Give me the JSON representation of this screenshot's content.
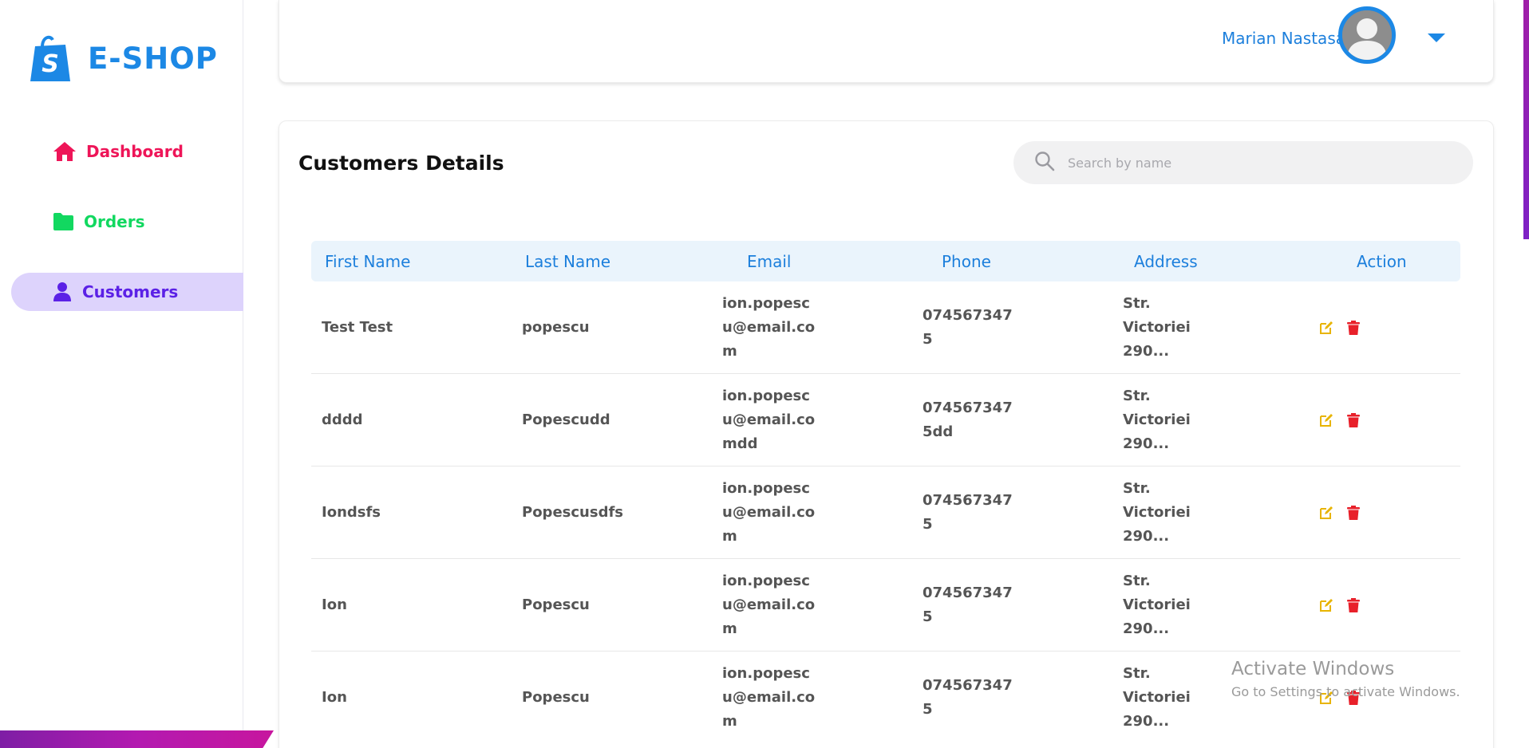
{
  "app": {
    "brand": "E-SHOP"
  },
  "sidebar": {
    "items": [
      {
        "label": "Dashboard",
        "icon": "home-icon",
        "color": "#ee1558"
      },
      {
        "label": "Orders",
        "icon": "folder-icon",
        "color": "#12d860"
      },
      {
        "label": "Customers",
        "icon": "user-icon",
        "color": "#5b21e6",
        "active": true
      }
    ]
  },
  "header": {
    "user_name": "Marian Nastasa"
  },
  "main": {
    "title": "Customers Details",
    "search": {
      "placeholder": "Search by name",
      "value": ""
    },
    "table": {
      "columns": [
        "First Name",
        "Last Name",
        "Email",
        "Phone",
        "Address",
        "Action"
      ],
      "rows": [
        {
          "first_name": "Test Test",
          "last_name": "popescu",
          "email": "ion.popescu@email.com",
          "phone": "0745673475",
          "address": "Str. Victoriei 290..."
        },
        {
          "first_name": "dddd",
          "last_name": "Popescudd",
          "email": "ion.popescu@email.comdd",
          "phone": "0745673475dd",
          "address": "Str. Victoriei 290..."
        },
        {
          "first_name": "Iondsfs",
          "last_name": "Popescusdfs",
          "email": "ion.popescu@email.com",
          "phone": "0745673475",
          "address": "Str. Victoriei 290..."
        },
        {
          "first_name": "Ion",
          "last_name": "Popescu",
          "email": "ion.popescu@email.com",
          "phone": "0745673475",
          "address": "Str. Victoriei 290..."
        },
        {
          "first_name": "Ion",
          "last_name": "Popescu",
          "email": "ion.popescu@email.com",
          "phone": "0745673475",
          "address": "Str. Victoriei 290..."
        }
      ]
    }
  },
  "watermark": {
    "line1": "Activate Windows",
    "line2": "Go to Settings to activate Windows."
  },
  "colors": {
    "accent": "#1c88e5",
    "edit": "#e8b400",
    "delete": "#e8202a"
  }
}
